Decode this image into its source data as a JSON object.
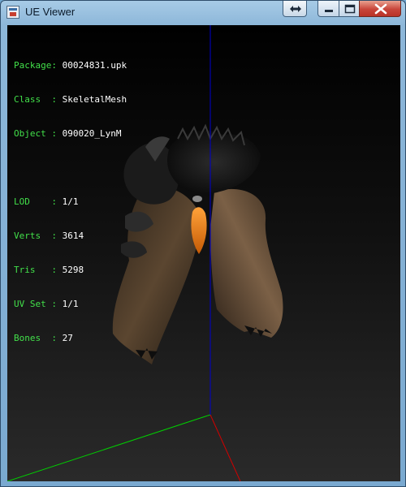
{
  "window": {
    "title": "UE Viewer",
    "icons": {
      "app": "app-icon",
      "extra": "swap-arrows-icon",
      "minimize": "minimize-icon",
      "maximize": "maximize-icon",
      "close": "close-icon"
    }
  },
  "info_panel": {
    "group1": [
      {
        "key": "Package:",
        "value": "00024831.upk"
      },
      {
        "key": "Class  :",
        "value": "SkeletalMesh"
      },
      {
        "key": "Object :",
        "value": "090020_LynM"
      }
    ],
    "group2": [
      {
        "key": "LOD    :",
        "value": "1/1"
      },
      {
        "key": "Verts  :",
        "value": "3614"
      },
      {
        "key": "Tris   :",
        "value": "5298"
      },
      {
        "key": "UV Set :",
        "value": "1/1"
      },
      {
        "key": "Bones  :",
        "value": "27"
      }
    ]
  },
  "viewport": {
    "background_top": "#000000",
    "background_bottom": "#2a2a2a",
    "axis_colors": {
      "x": "#ff0000",
      "y": "#00ff00",
      "z": "#0000ff"
    },
    "label_color": "#42e04a"
  }
}
